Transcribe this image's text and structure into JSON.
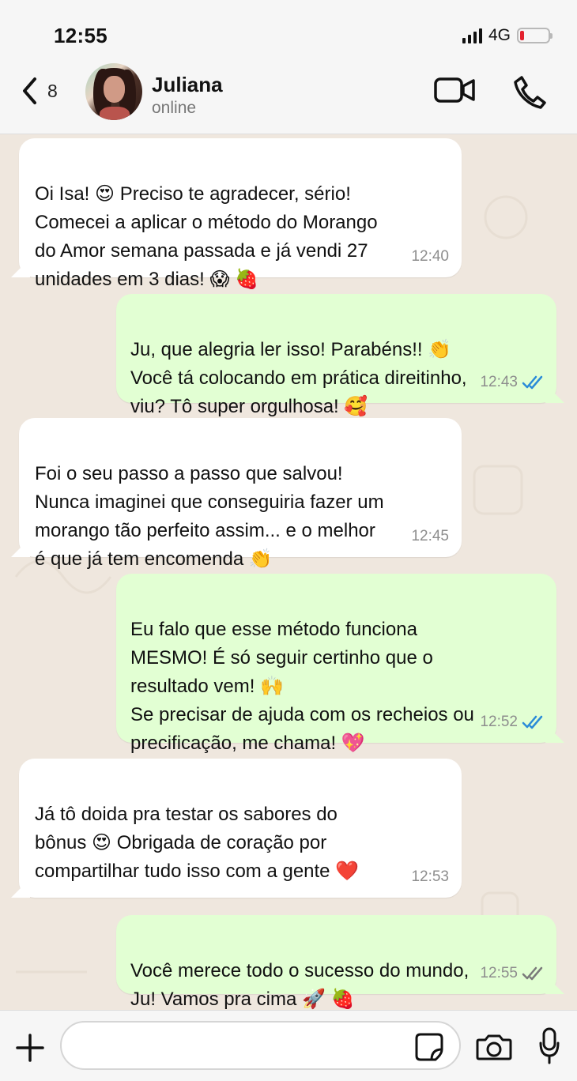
{
  "status_bar": {
    "time": "12:55",
    "network": "4G",
    "battery_level": 0.15,
    "colors": {
      "battery_low": "#e3222f"
    }
  },
  "header": {
    "back_count": "8",
    "contact_name": "Juliana",
    "contact_status": "online",
    "icons": [
      "chevron-left-icon",
      "video-call-icon",
      "phone-icon"
    ]
  },
  "messages": [
    {
      "direction": "in",
      "text": "Oi Isa! 😍 Preciso te agradecer, sério!\nComecei a aplicar o método do Morango\ndo Amor semana passada e já vendi 27\nunidades em 3 dias! 😱 🍓",
      "time": "12:40"
    },
    {
      "direction": "out",
      "text": "Ju, que alegria ler isso! Parabéns!! 👏\nVocê tá colocando em prática direitinho,\nviu? Tô super orgulhosa! 🥰",
      "time": "12:43",
      "read": true
    },
    {
      "direction": "in",
      "text": "Foi o seu passo a passo que salvou!\nNunca imaginei que conseguiria fazer um\nmorango tão perfeito assim... e o melhor\né que já tem encomenda 👏",
      "time": "12:45"
    },
    {
      "direction": "out",
      "text": "Eu falo que esse método funciona\nMESMO! É só seguir certinho que o\nresultado vem! 🙌\nSe precisar de ajuda com os recheios ou\nprecificação, me chama! 💖",
      "time": "12:52",
      "read": true
    },
    {
      "direction": "in",
      "text": "Já tô doida pra testar os sabores do\nbônus 😍 Obrigada de coração por\ncompartilhar tudo isso com a gente ❤️",
      "time": "12:53"
    },
    {
      "direction": "out",
      "text": "Você merece todo o sucesso do mundo,\nJu! Vamos pra cima 🚀 🍓",
      "time": "12:55",
      "read": false
    }
  ],
  "composer": {
    "placeholder": "",
    "icons": [
      "plus-icon",
      "sticker-icon",
      "camera-icon",
      "microphone-icon"
    ]
  },
  "colors": {
    "chat_background": "#efe7de",
    "incoming_bubble": "#ffffff",
    "outgoing_bubble": "#e2ffd3",
    "read_receipt": "#2a8bd8",
    "delivered_receipt": "#7a7a7a"
  }
}
